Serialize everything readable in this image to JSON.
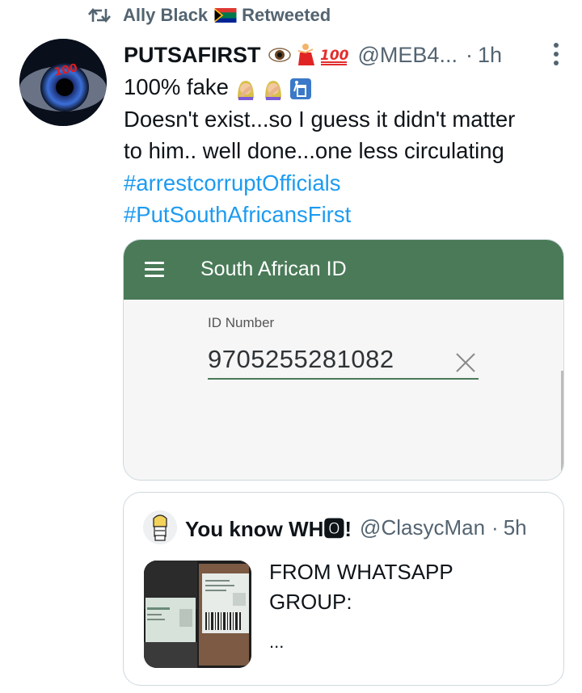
{
  "retweet": {
    "user": "Ally Black",
    "flag_icon": "south-africa-flag-icon",
    "label": "Retweeted"
  },
  "tweet": {
    "author_name": "PUTSAFIRST",
    "author_emojis": [
      "eye-icon",
      "dancer-icon",
      "hundred-icon"
    ],
    "handle": "@MEB4...",
    "dot": "·",
    "time": "1h",
    "line1": "100% fake",
    "line1_emojis": [
      "facepalm-woman-icon",
      "facepalm-woman-icon",
      "wastebasket-icon"
    ],
    "line2": "Doesn't exist...so I guess it didn't matter",
    "line3": "to him.. well done...one less circulating",
    "hashtag1": "#arrestcorruptOfficials",
    "hashtag2": "#PutSouthAfricansFirst"
  },
  "media": {
    "app_title": "South African ID",
    "field_label": "ID Number",
    "field_value": "9705255281082",
    "colors": {
      "appbar": "#4a7a58",
      "link": "#1d9bf0"
    }
  },
  "quote": {
    "author_name": "You know WH🅾!",
    "handle": "@ClasycMan",
    "dot": "·",
    "time": "5h",
    "text_line1": "FROM WHATSAPP",
    "text_line2": "GROUP:",
    "ellipsis": "..."
  }
}
